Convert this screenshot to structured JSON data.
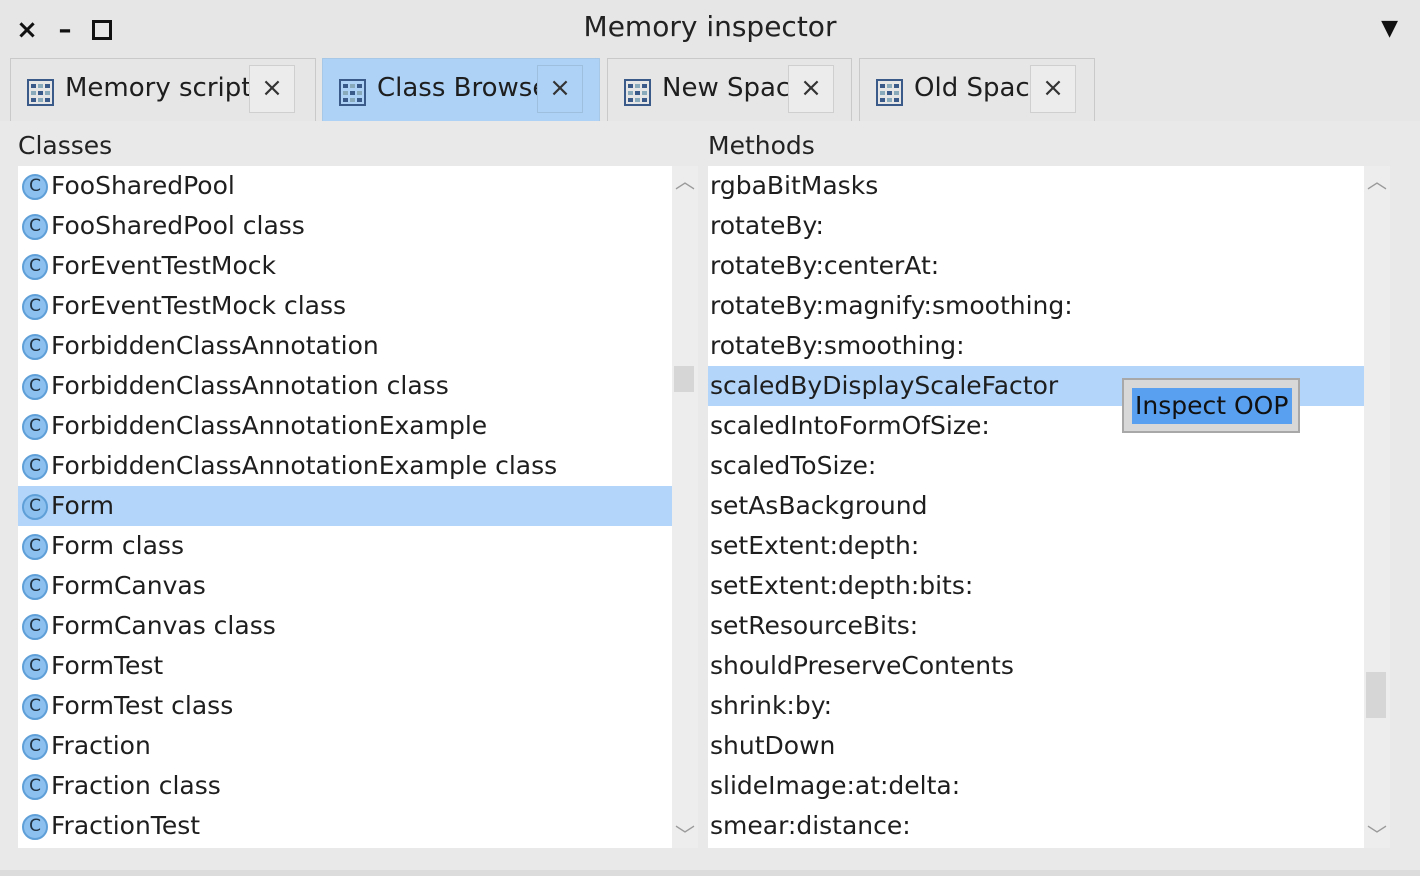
{
  "window": {
    "title": "Memory inspector",
    "close_glyph": "×",
    "minimize_glyph": "–",
    "menu_glyph": "▼"
  },
  "tabs": [
    {
      "label": "Memory scripter",
      "icon": "class-browser-icon",
      "active": false,
      "close_glyph": "×"
    },
    {
      "label": "Class Browser",
      "icon": "class-browser-icon",
      "active": true,
      "close_glyph": "×"
    },
    {
      "label": "New Space",
      "icon": "class-browser-icon",
      "active": false,
      "close_glyph": "×"
    },
    {
      "label": "Old Space",
      "icon": "class-browser-icon",
      "active": false,
      "close_glyph": "×"
    }
  ],
  "classes": {
    "title": "Classes",
    "icon_glyph": "C",
    "items": [
      "FooSharedPool",
      "FooSharedPool class",
      "ForEventTestMock",
      "ForEventTestMock class",
      "ForbiddenClassAnnotation",
      "ForbiddenClassAnnotation class",
      "ForbiddenClassAnnotationExample",
      "ForbiddenClassAnnotationExample class",
      "Form",
      "Form class",
      "FormCanvas",
      "FormCanvas class",
      "FormTest",
      "FormTest class",
      "Fraction",
      "Fraction class",
      "FractionTest"
    ],
    "selected": "Form"
  },
  "methods": {
    "title": "Methods",
    "items": [
      "rgbaBitMasks",
      "rotateBy:",
      "rotateBy:centerAt:",
      "rotateBy:magnify:smoothing:",
      "rotateBy:smoothing:",
      "scaledByDisplayScaleFactor",
      "scaledIntoFormOfSize:",
      "scaledToSize:",
      "setAsBackground",
      "setExtent:depth:",
      "setExtent:depth:bits:",
      "setResourceBits:",
      "shouldPreserveContents",
      "shrink:by:",
      "shutDown",
      "slideImage:at:delta:",
      "smear:distance:"
    ],
    "selected": "scaledByDisplayScaleFactor"
  },
  "context_menu": {
    "items": [
      "Inspect OOP"
    ]
  },
  "colors": {
    "selection": "#b3d5f9",
    "active_tab": "#add2f6",
    "menu_highlight": "#5aa0f0"
  }
}
